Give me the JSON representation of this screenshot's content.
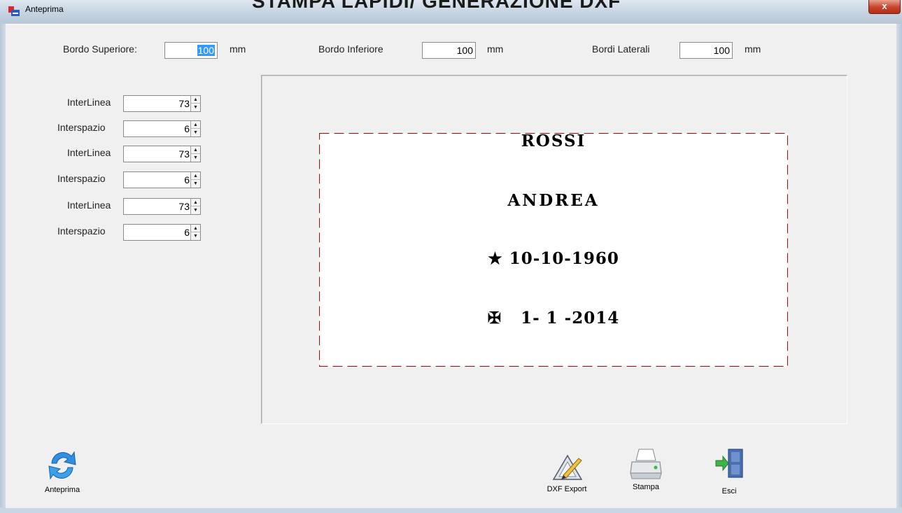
{
  "window": {
    "background_title": "STAMPA LAPIDI/ GENERAZIONE DXF",
    "title": "Anteprima",
    "close_label": "x"
  },
  "margins": {
    "top_label": "Bordo Superiore:",
    "top_value": "100",
    "bottom_label": "Bordo Inferiore",
    "bottom_value": "100",
    "side_label": "Bordi Laterali",
    "side_value": "100",
    "unit": "mm"
  },
  "spacing": [
    {
      "label": "InterLinea",
      "value": "73"
    },
    {
      "label": "Interspazio",
      "value": "6"
    },
    {
      "label": "InterLinea",
      "value": "73"
    },
    {
      "label": "Interspazio",
      "value": "6"
    },
    {
      "label": "InterLinea",
      "value": "73"
    },
    {
      "label": "Interspazio",
      "value": "6"
    }
  ],
  "plate": {
    "surname": "ROSSI",
    "name": "ANDREA",
    "birth": "★ 10-10-1960",
    "death": "✠   1- 1 -2014",
    "border_color": "#8b1a1a"
  },
  "toolbar": {
    "preview_label": "Anteprima",
    "dxf_label": "DXF Export",
    "print_label": "Stampa",
    "exit_label": "Esci"
  },
  "icons": {
    "refresh": "refresh-icon",
    "dxf": "drafting-icon",
    "print": "printer-icon",
    "exit": "exit-door-icon"
  }
}
